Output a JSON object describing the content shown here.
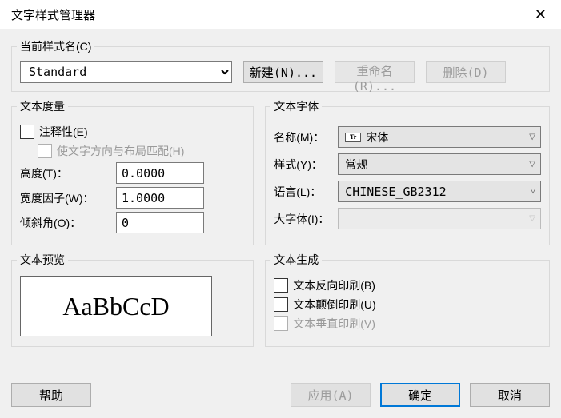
{
  "window": {
    "title": "文字样式管理器"
  },
  "current_style": {
    "legend": "当前样式名(C)",
    "selected": "Standard",
    "new_btn": "新建(N)...",
    "rename_btn": "重命名(R)...",
    "delete_btn": "删除(D)"
  },
  "metrics": {
    "legend": "文本度量",
    "annotative": "注释性(E)",
    "match_orient": "使文字方向与布局匹配(H)",
    "height_label": "高度(T)：",
    "height_value": "0.0000",
    "width_label": "宽度因子(W)：",
    "width_value": "1.0000",
    "oblique_label": "倾斜角(O)：",
    "oblique_value": "0"
  },
  "font": {
    "legend": "文本字体",
    "name_label": "名称(M)：",
    "name_value": "宋体",
    "style_label": "样式(Y)：",
    "style_value": "常规",
    "lang_label": "语言(L)：",
    "lang_value": "CHINESE_GB2312",
    "bigfont_label": "大字体(I)："
  },
  "preview": {
    "legend": "文本预览",
    "text": "AaBbCcD"
  },
  "effects": {
    "legend": "文本生成",
    "backwards": "文本反向印刷(B)",
    "upsidedown": "文本颠倒印刷(U)",
    "vertical": "文本垂直印刷(V)"
  },
  "footer": {
    "help": "帮助",
    "apply": "应用(A)",
    "ok": "确定",
    "cancel": "取消"
  }
}
